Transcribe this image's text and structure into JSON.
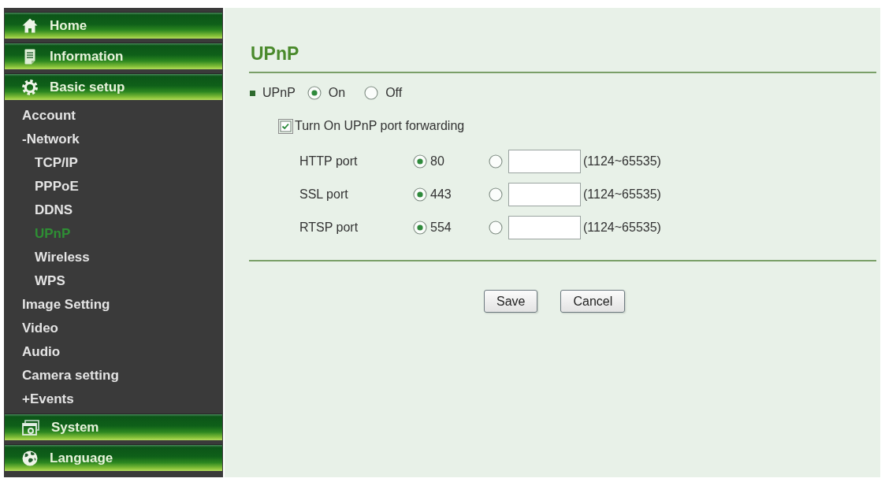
{
  "sidebar": {
    "sections": [
      {
        "label": "Home"
      },
      {
        "label": "Information"
      },
      {
        "label": "Basic setup",
        "children": [
          {
            "label": "Account",
            "selected": false
          },
          {
            "label": "-Network",
            "selected": false,
            "children": [
              {
                "label": "TCP/IP",
                "selected": false
              },
              {
                "label": "PPPoE",
                "selected": false
              },
              {
                "label": "DDNS",
                "selected": false
              },
              {
                "label": "UPnP",
                "selected": true
              },
              {
                "label": "Wireless",
                "selected": false
              },
              {
                "label": "WPS",
                "selected": false
              }
            ]
          },
          {
            "label": "Image Setting",
            "selected": false
          },
          {
            "label": "Video",
            "selected": false
          },
          {
            "label": "Audio",
            "selected": false
          },
          {
            "label": "Camera setting",
            "selected": false
          },
          {
            "label": "+Events",
            "selected": false
          }
        ]
      },
      {
        "label": "System"
      },
      {
        "label": "Language"
      }
    ]
  },
  "main": {
    "title": "UPnP",
    "upnp": {
      "label": "UPnP",
      "options": [
        {
          "label": "On",
          "selected": true
        },
        {
          "label": "Off",
          "selected": false
        }
      ]
    },
    "port_forwarding": {
      "label": "Turn On UPnP port forwarding",
      "checked": true
    },
    "ports": [
      {
        "label": "HTTP port",
        "default": {
          "value": "80",
          "selected": true
        },
        "custom": {
          "selected": false,
          "range": "(1124~65535)"
        }
      },
      {
        "label": "SSL port",
        "default": {
          "value": "443",
          "selected": true
        },
        "custom": {
          "selected": false,
          "range": "(1124~65535)"
        }
      },
      {
        "label": "RTSP port",
        "default": {
          "value": "554",
          "selected": true
        },
        "custom": {
          "selected": false,
          "range": "(1124~65535)"
        }
      }
    ],
    "buttons": [
      "Save",
      "Cancel"
    ]
  }
}
